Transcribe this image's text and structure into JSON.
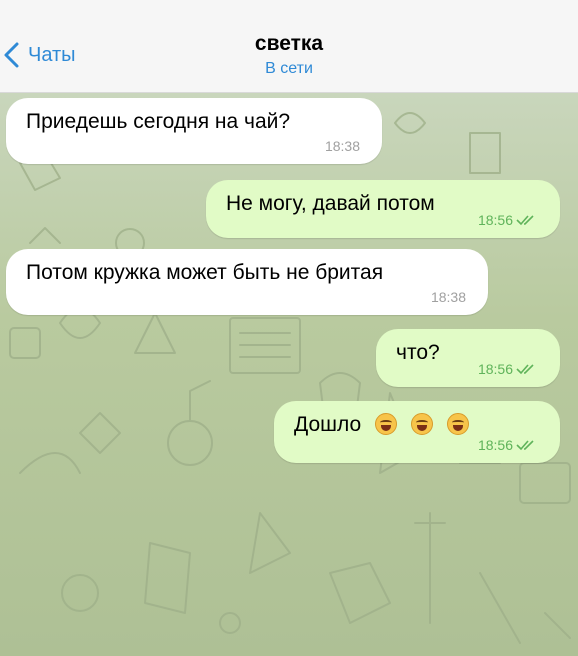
{
  "header": {
    "back_label": "Чаты",
    "title": "светка",
    "status": "В сети"
  },
  "colors": {
    "accent": "#2f8ad6",
    "incoming_bubble": "#ffffff",
    "outgoing_bubble": "#e1fbc6",
    "read_ticks": "#5fb35a"
  },
  "messages": [
    {
      "direction": "in",
      "text": "Приедешь сегодня на чай?",
      "time": "18:38"
    },
    {
      "direction": "out",
      "text": "Не могу, давай потом",
      "time": "18:56",
      "status": "read"
    },
    {
      "direction": "in",
      "text": "Потом кружка может быть не бритая",
      "time": "18:38"
    },
    {
      "direction": "out",
      "text": "что?",
      "time": "18:56",
      "status": "read"
    },
    {
      "direction": "out",
      "text": "Дошло",
      "time": "18:56",
      "status": "read",
      "emoji": [
        "joy-emoji",
        "joy-emoji",
        "joy-emoji"
      ]
    }
  ]
}
